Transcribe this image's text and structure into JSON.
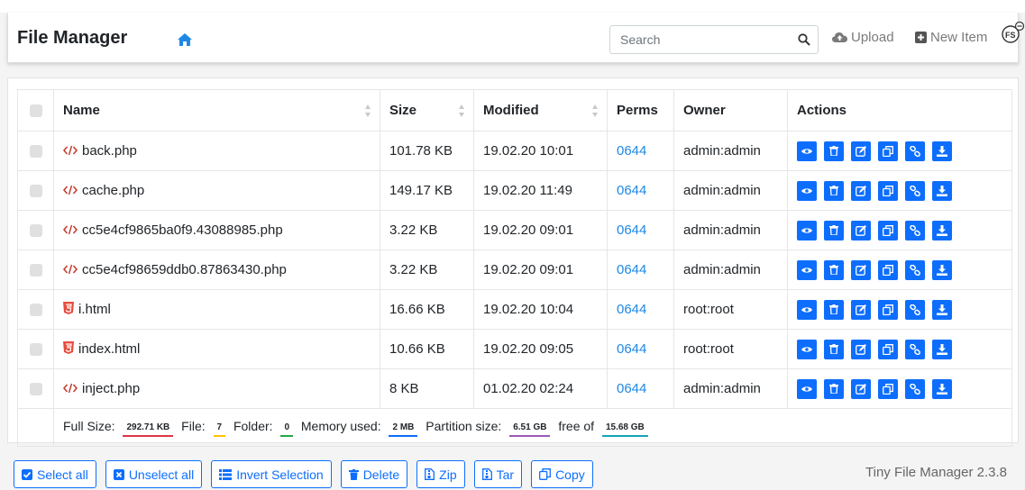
{
  "header": {
    "brand": "File Manager",
    "search_placeholder": "Search",
    "upload_label": "Upload",
    "new_item_label": "New Item"
  },
  "table": {
    "columns": [
      "Name",
      "Size",
      "Modified",
      "Perms",
      "Owner",
      "Actions"
    ],
    "rows": [
      {
        "name": "back.php",
        "type": "php",
        "size": "101.78 KB",
        "modified": "19.02.20 10:01",
        "perms": "0644",
        "owner": "admin:admin"
      },
      {
        "name": "cache.php",
        "type": "php",
        "size": "149.17 KB",
        "modified": "19.02.20 11:49",
        "perms": "0644",
        "owner": "admin:admin"
      },
      {
        "name": "cc5e4cf9865ba0f9.43088985.php",
        "type": "php",
        "size": "3.22 KB",
        "modified": "19.02.20 09:01",
        "perms": "0644",
        "owner": "admin:admin"
      },
      {
        "name": "cc5e4cf98659ddb0.87863430.php",
        "type": "php",
        "size": "3.22 KB",
        "modified": "19.02.20 09:01",
        "perms": "0644",
        "owner": "admin:admin"
      },
      {
        "name": "i.html",
        "type": "html",
        "size": "16.66 KB",
        "modified": "19.02.20 10:04",
        "perms": "0644",
        "owner": "root:root"
      },
      {
        "name": "index.html",
        "type": "html",
        "size": "10.66 KB",
        "modified": "19.02.20 09:05",
        "perms": "0644",
        "owner": "root:root"
      },
      {
        "name": "inject.php",
        "type": "php",
        "size": "8 KB",
        "modified": "01.02.20 02:24",
        "perms": "0644",
        "owner": "admin:admin"
      }
    ],
    "action_icons": [
      "eye-icon",
      "trash-icon",
      "edit-icon",
      "copy-icon",
      "link-icon",
      "download-icon"
    ]
  },
  "stats": {
    "full_size_label": "Full Size:",
    "full_size": "292.71 KB",
    "file_label": "File:",
    "file_count": "7",
    "folder_label": "Folder:",
    "folder_count": "0",
    "memory_label": "Memory used:",
    "memory": "2 MB",
    "partition_label": "Partition size:",
    "partition": "6.51 GB",
    "free_of_label": "free of",
    "total": "15.68 GB"
  },
  "bottom_buttons": [
    {
      "label": "Select all",
      "icon": "check-square-icon"
    },
    {
      "label": "Unselect all",
      "icon": "x-square-icon"
    },
    {
      "label": "Invert Selection",
      "icon": "list-icon"
    },
    {
      "label": "Delete",
      "icon": "trash-icon"
    },
    {
      "label": "Zip",
      "icon": "file-archive-icon"
    },
    {
      "label": "Tar",
      "icon": "file-archive-icon"
    },
    {
      "label": "Copy",
      "icon": "copy-icon"
    }
  ],
  "version": "Tiny File Manager 2.3.8",
  "colors": {
    "accent": "#0d6efd",
    "link": "#1e88e5",
    "php_icon": "#c0392b",
    "html_icon": "#e74c3c",
    "badge_full": "#dc3545",
    "badge_file": "#ffc107",
    "badge_folder": "#28a745",
    "badge_memory": "#0d6efd",
    "badge_partition": "#9b59b6",
    "badge_total": "#17a2b8"
  }
}
